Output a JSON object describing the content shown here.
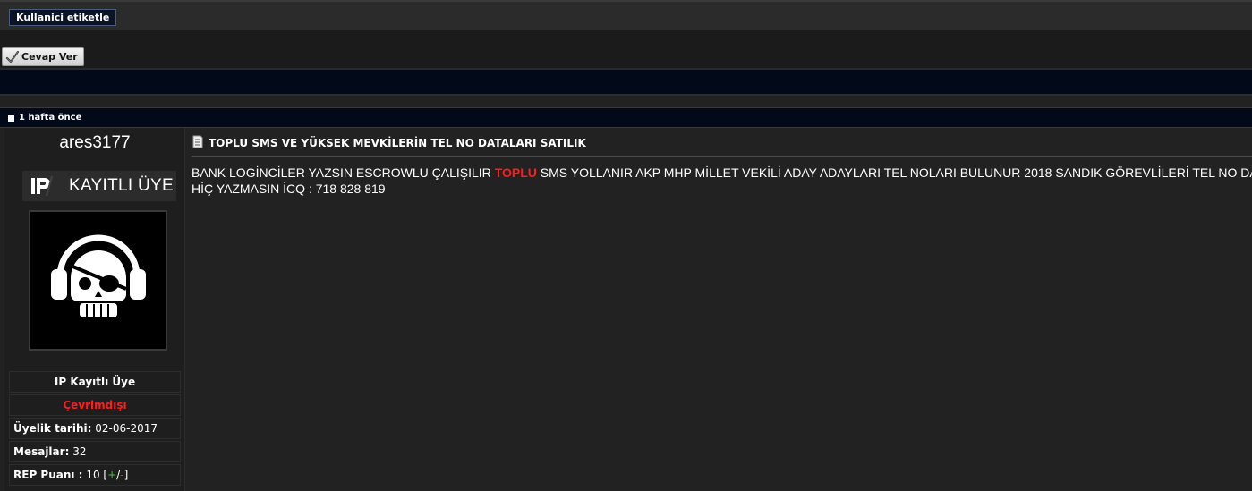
{
  "topbar": {
    "tag_label": "Kullanici etiketle"
  },
  "reply": {
    "label": "Cevap Ver"
  },
  "post_header": {
    "time": "1 hafta önce"
  },
  "user": {
    "username": "ares3177",
    "rank": "KAYITLI ÜYE",
    "title": "IP Kayıtlı Üye",
    "status": "Çevrimdışı",
    "member_since_label": "Üyelik tarihi:",
    "member_since_value": "02-06-2017",
    "messages_label": "Mesajlar:",
    "messages_value": "32",
    "rep_label": "REP Puanı :",
    "rep_value": "10",
    "rep_open": "[",
    "rep_plus": "+",
    "rep_sep": "/",
    "rep_minus": "-",
    "rep_close": "]"
  },
  "post": {
    "title": "TOPLU SMS VE YÜKSEK MEVKİLERİN TEL NO DATALARI SATILIK",
    "body_part1": "BANK LOGİNCİLER YAZSIN ESCROWLU ÇALIŞILIR ",
    "body_highlight": "TOPLU",
    "body_part2": " SMS YOLLANIR AKP MHP MİLLET VEKİLİ ADAY ADAYLARI TEL NOLARI BULUNUR 2018 SANDIK GÖREVLİLERİ TEL NO DATA",
    "body_line2": "HİÇ YAZMASIN İCQ : 718 828 819"
  },
  "colors": {
    "background": "#222222",
    "navy": "#020a1a",
    "highlight_red": "#ff1c1c"
  },
  "icons": {
    "reply": "checkmark-icon",
    "post": "post-icon",
    "title": "document-icon",
    "rank": "ip-logo-icon",
    "avatar": "pirate-skull-headphones-icon"
  }
}
